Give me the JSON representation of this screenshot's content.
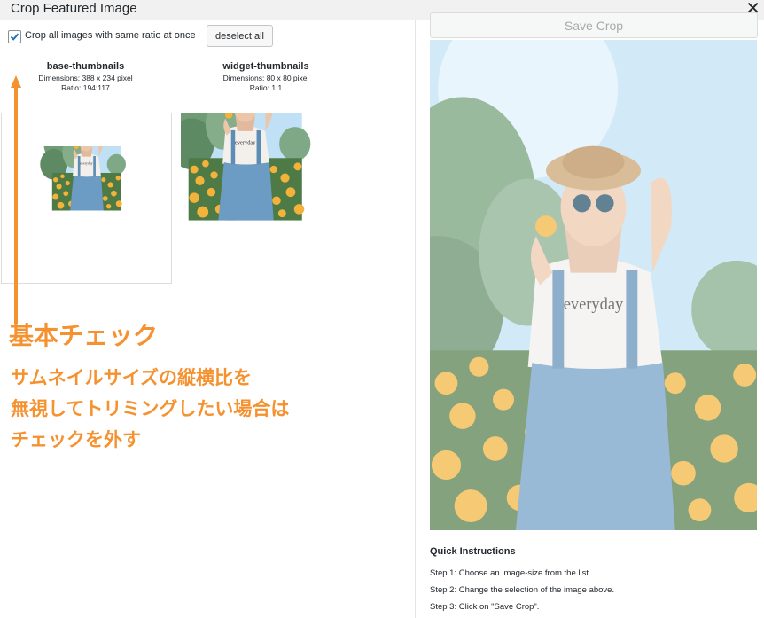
{
  "dialog": {
    "title": "Crop Featured Image"
  },
  "options": {
    "crop_all_label": "Crop all images with same ratio at once",
    "crop_all_checked": true,
    "deselect_label": "deselect all"
  },
  "sizes": [
    {
      "name": "base-thumbnails",
      "dimensions": "Dimensions: 388 x 234 pixel",
      "ratio": "Ratio: 194:117"
    },
    {
      "name": "widget-thumbnails",
      "dimensions": "Dimensions: 80 x 80 pixel",
      "ratio": "Ratio: 1:1"
    }
  ],
  "annotation": {
    "heading": "基本チェック",
    "lines": [
      "サムネイルサイズの縦横比を",
      "無視してトリミングしたい場合は",
      "チェックを外す"
    ],
    "color": "#f5922f"
  },
  "crop": {
    "save_label": "Save Crop"
  },
  "instructions": {
    "title": "Quick Instructions",
    "steps": [
      "Step 1: Choose an image-size from the list.",
      "Step 2: Change the selection of the image above.",
      "Step 3: Click on \"Save Crop\"."
    ]
  }
}
